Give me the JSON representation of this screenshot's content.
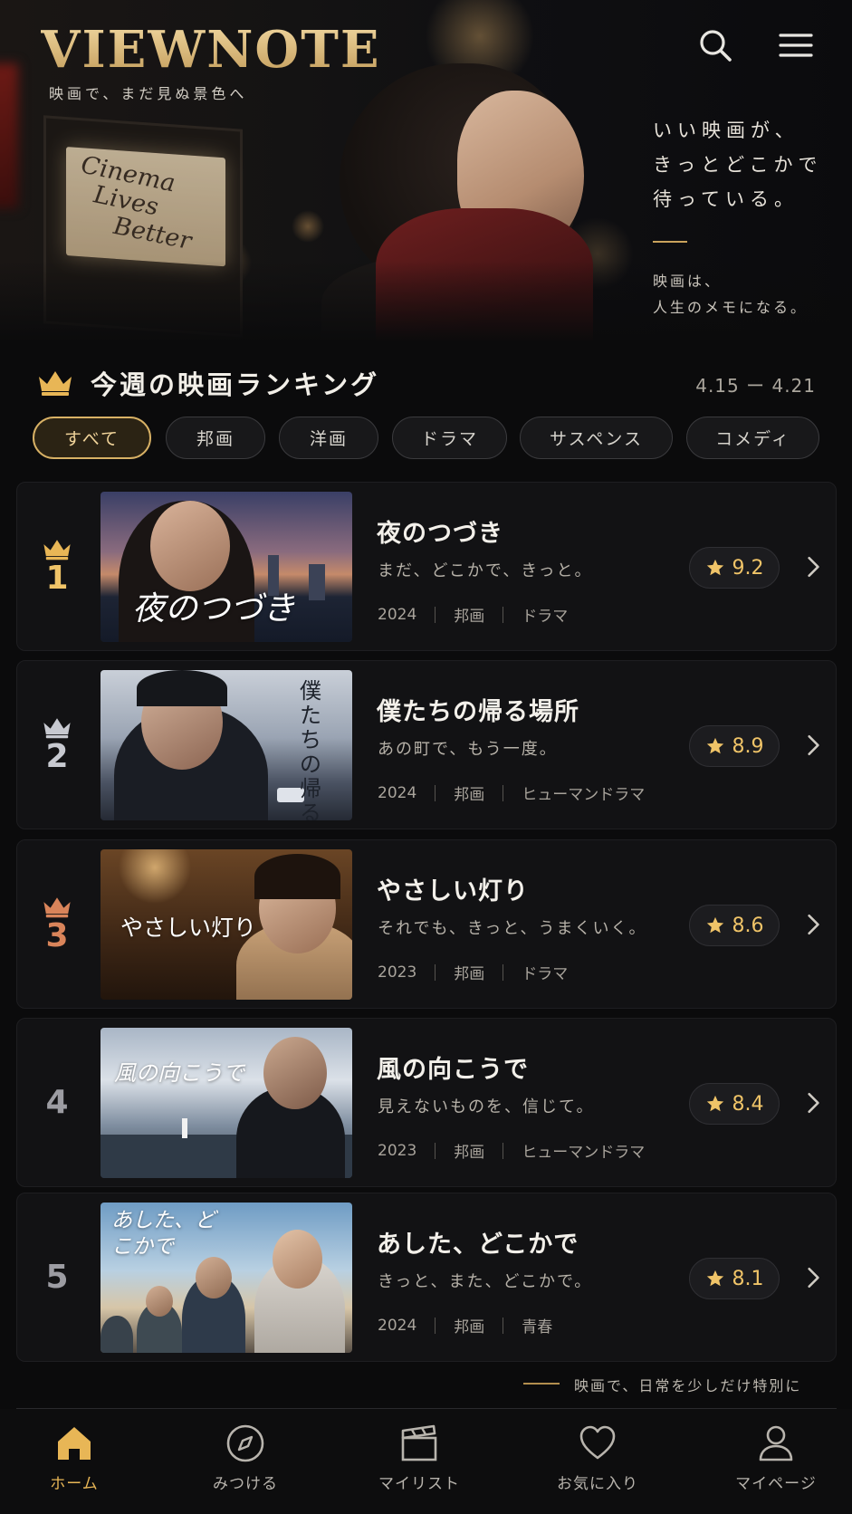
{
  "hero": {
    "logo": "VIEWNOTE",
    "tagline": "映画で、まだ見ぬ景色へ",
    "sign_text": [
      "Cinema",
      "Lives",
      "Better"
    ],
    "copy_lines": [
      "いい映画が、",
      "きっとどこかで",
      "待っている。"
    ],
    "sub_lines": [
      "映画は、",
      "人生のメモになる。"
    ],
    "icons": {
      "search": "search-icon",
      "menu": "menu-icon"
    }
  },
  "ranking": {
    "title": "今週の映画ランキング",
    "date_range": "4.15 ー 4.21",
    "chips": [
      "すべて",
      "邦画",
      "洋画",
      "ドラマ",
      "サスペンス",
      "コメディ"
    ],
    "active_chip": "すべて",
    "items": [
      {
        "rank": "1",
        "title": "夜のつづき",
        "tagline": "まだ、どこかで、きっと。",
        "year": "2024",
        "region": "邦画",
        "genre": "ドラマ",
        "rating": "9.2",
        "thumb_text": "夜のつづき",
        "crown_color": "#e8b656"
      },
      {
        "rank": "2",
        "title": "僕たちの帰る場所",
        "tagline": "あの町で、もう一度。",
        "year": "2024",
        "region": "邦画",
        "genre": "ヒューマンドラマ",
        "rating": "8.9",
        "thumb_text": "僕たちの帰る場所",
        "crown_color": "#c7c9d0"
      },
      {
        "rank": "3",
        "title": "やさしい灯り",
        "tagline": "それでも、きっと、うまくいく。",
        "year": "2023",
        "region": "邦画",
        "genre": "ドラマ",
        "rating": "8.6",
        "thumb_text": "やさしい灯り",
        "crown_color": "#d9845a"
      },
      {
        "rank": "4",
        "title": "風の向こうで",
        "tagline": "見えないものを、信じて。",
        "year": "2023",
        "region": "邦画",
        "genre": "ヒューマンドラマ",
        "rating": "8.4",
        "thumb_text": "風の向こうで"
      },
      {
        "rank": "5",
        "title": "あした、どこかで",
        "tagline": "きっと、また、どこかで。",
        "year": "2024",
        "region": "邦画",
        "genre": "青春",
        "rating": "8.1",
        "thumb_text": "あした、どこかで"
      }
    ]
  },
  "footer_text": "映画で、日常を少しだけ特別に",
  "nav": [
    {
      "label": "ホーム",
      "icon": "home-icon",
      "active": true
    },
    {
      "label": "みつける",
      "icon": "compass-icon",
      "active": false
    },
    {
      "label": "マイリスト",
      "icon": "clapperboard-icon",
      "active": false
    },
    {
      "label": "お気に入り",
      "icon": "heart-icon",
      "active": false
    },
    {
      "label": "マイページ",
      "icon": "user-icon",
      "active": false
    }
  ],
  "colors": {
    "accent": "#e8b656",
    "background": "#0b0b0c",
    "rating": "#f0c468"
  }
}
